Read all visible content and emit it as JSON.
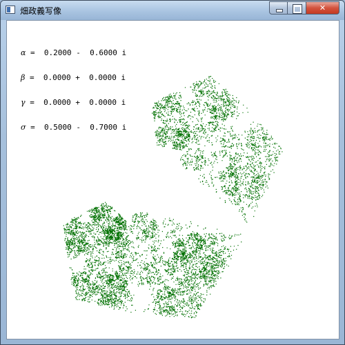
{
  "window": {
    "title": "畑政義写像",
    "controls": {
      "minimize": "minimize",
      "maximize": "maximize",
      "close": "✕"
    }
  },
  "params": [
    {
      "symbol": "α",
      "text": " =  0.2000 -  0.6000 i"
    },
    {
      "symbol": "β",
      "text": " =  0.0000 +  0.0000 i"
    },
    {
      "symbol": "γ",
      "text": " =  0.0000 +  0.0000 i"
    },
    {
      "symbol": "σ",
      "text": " =  0.5000 -  0.7000 i"
    }
  ],
  "colors": {
    "fractal": "#007000",
    "background": "#ffffff"
  }
}
